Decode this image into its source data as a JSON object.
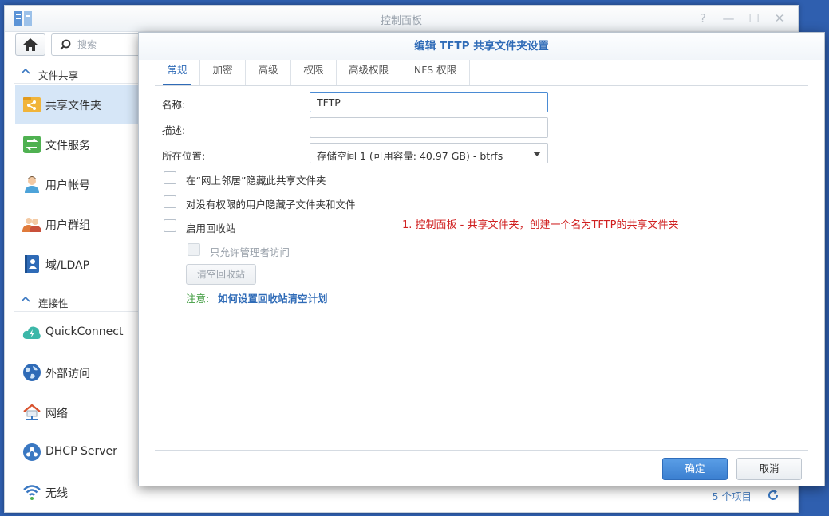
{
  "window": {
    "title": "控制面板",
    "controls": {
      "help": "?",
      "minimize": "—",
      "maximize": "☐",
      "close": "✕"
    }
  },
  "search": {
    "placeholder": "搜索"
  },
  "sidebar": {
    "sections": [
      {
        "title": "文件共享",
        "items": [
          {
            "label": "共享文件夹",
            "icon": "shared-folder-icon",
            "active": true
          },
          {
            "label": "文件服务",
            "icon": "file-services-icon"
          },
          {
            "label": "用户帐号",
            "icon": "user-icon"
          },
          {
            "label": "用户群组",
            "icon": "group-icon"
          },
          {
            "label": "域/LDAP",
            "icon": "domain-ldap-icon"
          }
        ]
      },
      {
        "title": "连接性",
        "items": [
          {
            "label": "QuickConnect",
            "icon": "quickconnect-icon"
          },
          {
            "label": "外部访问",
            "icon": "globe-icon"
          },
          {
            "label": "网络",
            "icon": "network-icon"
          },
          {
            "label": "DHCP Server",
            "icon": "dhcp-icon"
          },
          {
            "label": "无线",
            "icon": "wifi-icon"
          }
        ]
      }
    ]
  },
  "content_footer": {
    "count": "5 个项目"
  },
  "dialog": {
    "title": "编辑 TFTP 共享文件夹设置",
    "tabs": [
      "常规",
      "加密",
      "高级",
      "权限",
      "高级权限",
      "NFS 权限"
    ],
    "active_tab": "常规",
    "fields": {
      "name": {
        "label": "名称:",
        "value": "TFTP"
      },
      "description": {
        "label": "描述:",
        "value": ""
      },
      "location": {
        "label": "所在位置:",
        "value": "存储空间 1 (可用容量:  40.97 GB) - btrfs"
      }
    },
    "checkboxes": {
      "hide_network": {
        "label": "在“网上邻居”隐藏此共享文件夹",
        "checked": false
      },
      "hide_subfolders": {
        "label": "对没有权限的用户隐藏子文件夹和文件",
        "checked": false
      },
      "recycle_bin": {
        "label": "启用回收站",
        "checked": false
      },
      "admin_only": {
        "label": "只允许管理者访问",
        "checked": false,
        "disabled": true
      }
    },
    "empty_recycle_label": "清空回收站",
    "note_label": "注意:",
    "note_link": "如何设置回收站清空计划",
    "annotation": "1. 控制面板 - 共享文件夹，创建一个名为TFTP的共享文件夹",
    "ok_label": "确定",
    "cancel_label": "取消"
  },
  "colors": {
    "desktop": "#2f5faf",
    "accent": "#2f6bb7",
    "sidebar_active": "#d6e6f7",
    "annotation": "#d02020",
    "note": "#3d9a3d"
  }
}
